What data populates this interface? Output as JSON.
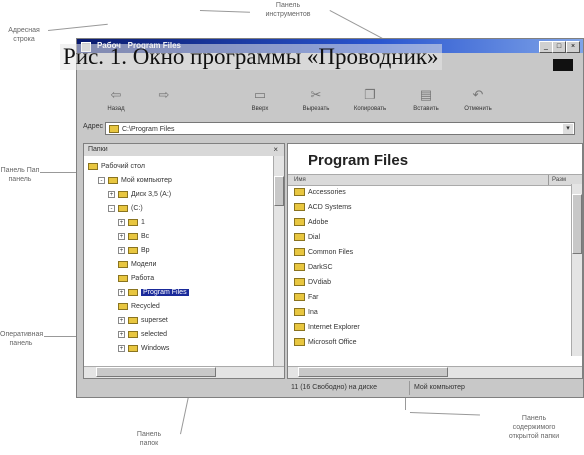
{
  "caption": "Рис. 1. Окно программы «Проводник»",
  "callouts": {
    "top_center": "р\u0000\u0000\u0000\u0000\u0000",
    "toolbar_panel": "Панель\nинструментов",
    "address_bar": "Адресная\nстрока",
    "explorer_panel": "Панель Пап\nпанель",
    "explorer_panel_lower": "Оперативная\nпанель",
    "folders_panel": "Панель\nпапок",
    "contents_panel": "Панель\nсодержимого\nоткрытой папки"
  },
  "window": {
    "title": "Program Files",
    "title_prefix": "Рабоч",
    "controls": {
      "minimize": "_",
      "maximize": "□",
      "close": "×"
    }
  },
  "toolbar": {
    "buttons": [
      {
        "label": "Назад",
        "icon": "back-arrow-icon",
        "glyph": "⇦"
      },
      {
        "label": "",
        "icon": "forward-arrow-icon",
        "glyph": "⇨"
      },
      {
        "label": "Вверх",
        "icon": "up-folder-icon",
        "glyph": "▭"
      },
      {
        "label": "Вырезать",
        "icon": "scissors-icon",
        "glyph": "✂"
      },
      {
        "label": "Копировать",
        "icon": "copy-icon",
        "glyph": "❐"
      },
      {
        "label": "Вставить",
        "icon": "paste-icon",
        "glyph": "▤"
      },
      {
        "label": "Отменить",
        "icon": "undo-icon",
        "glyph": "↶"
      }
    ]
  },
  "address": {
    "label": "Адрес",
    "value": "C:\\Program Files"
  },
  "folders_pane": {
    "header": "Папки",
    "close": "×",
    "tree": [
      {
        "label": "Рабочий стол",
        "level": 0,
        "expander": ""
      },
      {
        "label": "Мой компьютер",
        "level": 1,
        "expander": "-"
      },
      {
        "label": "Диск 3,5 (A:)",
        "level": 2,
        "expander": "+"
      },
      {
        "label": "(C:)",
        "level": 2,
        "expander": "-"
      },
      {
        "label": "1",
        "level": 3,
        "expander": "+"
      },
      {
        "label": "Bc",
        "level": 3,
        "expander": "+"
      },
      {
        "label": "Bp",
        "level": 3,
        "expander": "+"
      },
      {
        "label": "Модели",
        "level": 3,
        "expander": ""
      },
      {
        "label": "Работа",
        "level": 3,
        "expander": ""
      },
      {
        "label": "Program Files",
        "level": 3,
        "expander": "+",
        "selected": true
      },
      {
        "label": "Recycled",
        "level": 3,
        "expander": ""
      },
      {
        "label": "superset",
        "level": 3,
        "expander": "+"
      },
      {
        "label": "selected",
        "level": 3,
        "expander": "+"
      },
      {
        "label": "Windows",
        "level": 3,
        "expander": "+"
      }
    ]
  },
  "contents_pane": {
    "title": "Program Files",
    "columns": {
      "name": "Имя",
      "size": "Разм"
    },
    "items": [
      "Accessories",
      "ACD Systems",
      "Adobe",
      "Dial",
      "Common Files",
      "DarkSC",
      "DVdiab",
      "Far",
      "Ina",
      "Internet Explorer",
      "Microsoft Office"
    ]
  },
  "status": {
    "objects": "11 (16 Свободно) на диске",
    "location": "Мой компьютер"
  }
}
